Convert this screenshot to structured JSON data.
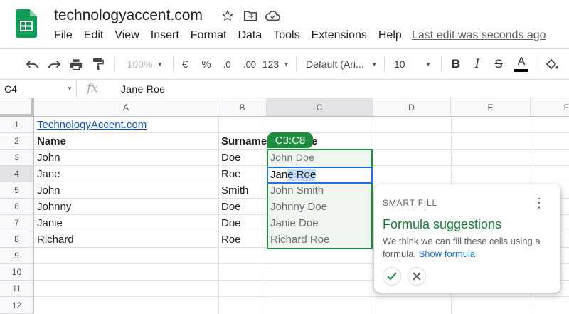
{
  "app": {
    "doc_title": "technologyaccent.com",
    "logo_icon": "sheets-logo-icon",
    "menu": [
      "File",
      "Edit",
      "View",
      "Insert",
      "Format",
      "Data",
      "Tools",
      "Extensions",
      "Help"
    ],
    "last_edit": "Last edit was seconds ago"
  },
  "toolbar": {
    "zoom": "100%",
    "currency": "€",
    "percent": "%",
    "dec_decrease": ".0",
    "dec_increase": ".00",
    "more_formats": "123",
    "font": "Default (Ari...",
    "font_size": "10"
  },
  "formula_bar": {
    "name_box": "C4",
    "fx": "fx",
    "content": "Jane  Roe"
  },
  "grid": {
    "columns": [
      "A",
      "B",
      "C",
      "D",
      "E",
      "F"
    ],
    "rows": [
      "1",
      "2",
      "3",
      "4",
      "5",
      "6",
      "7",
      "8",
      "9",
      "10",
      "11",
      "12"
    ],
    "a1_link": "TechnologyAccent.com",
    "headers": {
      "name": "Name",
      "surname": "Surname",
      "c2_tail": "e"
    },
    "names": [
      "John",
      "Jane",
      "John",
      "Johnny",
      "Janie",
      "Richard"
    ],
    "surnames": [
      "Doe",
      "Roe",
      "Smith",
      "Doe",
      "Doe",
      "Roe"
    ],
    "suggestions": {
      "c3": "John  Doe",
      "c5": "John Smith",
      "c6": "Johnny Doe",
      "c7": "Janie Doe",
      "c8": "Richard Roe"
    },
    "active_typed_plain": "Jan",
    "active_typed_highlight": "e Roe",
    "range_chip": "C3:C8"
  },
  "smart_fill": {
    "label": "SMART FILL",
    "title": "Formula suggestions",
    "body": "We think we can fill these cells using a formula.",
    "link": "Show formula"
  },
  "colors": {
    "accent_green": "#1e8e3e",
    "selection_blue": "#1a73e8",
    "link_blue": "#1155cc"
  }
}
